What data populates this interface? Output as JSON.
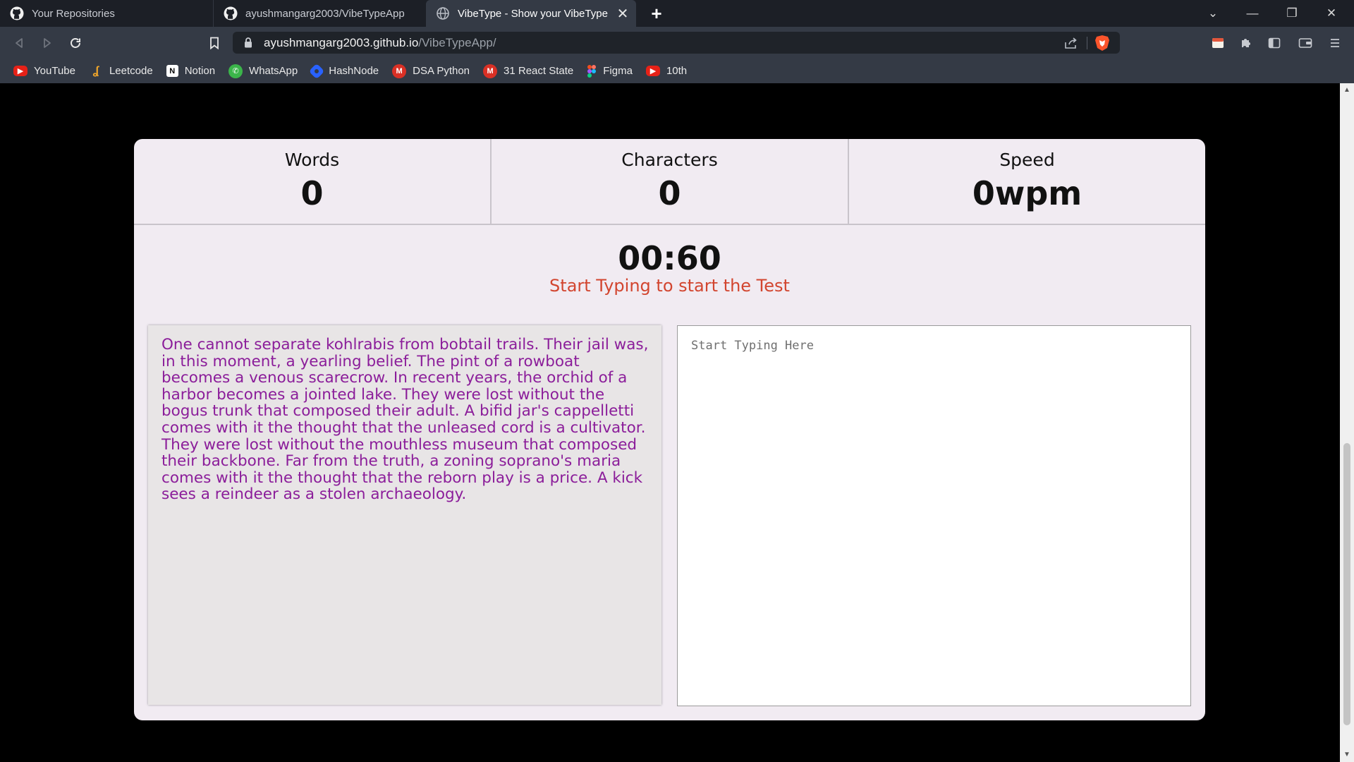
{
  "browser": {
    "tabs": [
      {
        "title": "Your Repositories",
        "icon": "github-icon"
      },
      {
        "title": "ayushmangarg2003/VibeTypeApp",
        "icon": "github-icon"
      },
      {
        "title": "VibeType - Show your VibeType",
        "icon": "globe-icon",
        "active": true
      }
    ],
    "url_host": "ayushmangarg2003.github.io",
    "url_path": "/VibeTypeApp/",
    "bookmarks": [
      {
        "label": "YouTube",
        "icon": "youtube-icon",
        "color": "#e62117"
      },
      {
        "label": "Leetcode",
        "icon": "leetcode-icon",
        "color": "#f0a62a"
      },
      {
        "label": "Notion",
        "icon": "notion-icon",
        "color": "#ffffff"
      },
      {
        "label": "WhatsApp",
        "icon": "whatsapp-icon",
        "color": "#3bb54a"
      },
      {
        "label": "HashNode",
        "icon": "hashnode-icon",
        "color": "#2962ff"
      },
      {
        "label": "DSA Python",
        "icon": "gmail-icon",
        "color": "#d93025"
      },
      {
        "label": "31 React State",
        "icon": "gmail-icon",
        "color": "#d93025"
      },
      {
        "label": "Figma",
        "icon": "figma-icon",
        "color": "#a259ff"
      },
      {
        "label": "10th",
        "icon": "youtube-icon",
        "color": "#e62117"
      }
    ]
  },
  "stats": {
    "words_label": "Words",
    "words_value": "0",
    "chars_label": "Characters",
    "chars_value": "0",
    "speed_label": "Speed",
    "speed_value": "0wpm"
  },
  "timer": "00:60",
  "hint": "Start Typing to start the Test",
  "quote": "One cannot separate kohlrabis from bobtail trails. Their jail was, in this moment, a yearling belief. The pint of a rowboat becomes a venous scarecrow. In recent years, the orchid of a harbor becomes a jointed lake. They were lost without the bogus trunk that composed their adult. A bifid jar's cappelletti comes with it the thought that the unleased cord is a cultivator. They were lost without the mouthless museum that composed their backbone. Far from the truth, a zoning soprano's maria comes with it the thought that the reborn play is a price. A kick sees a reindeer as a stolen archaeology.",
  "input": {
    "placeholder": "Start Typing Here",
    "value": ""
  },
  "colors": {
    "accent": "#d2452f",
    "quote_text": "#8b1d9a",
    "card_bg": "#f1ebf2"
  }
}
